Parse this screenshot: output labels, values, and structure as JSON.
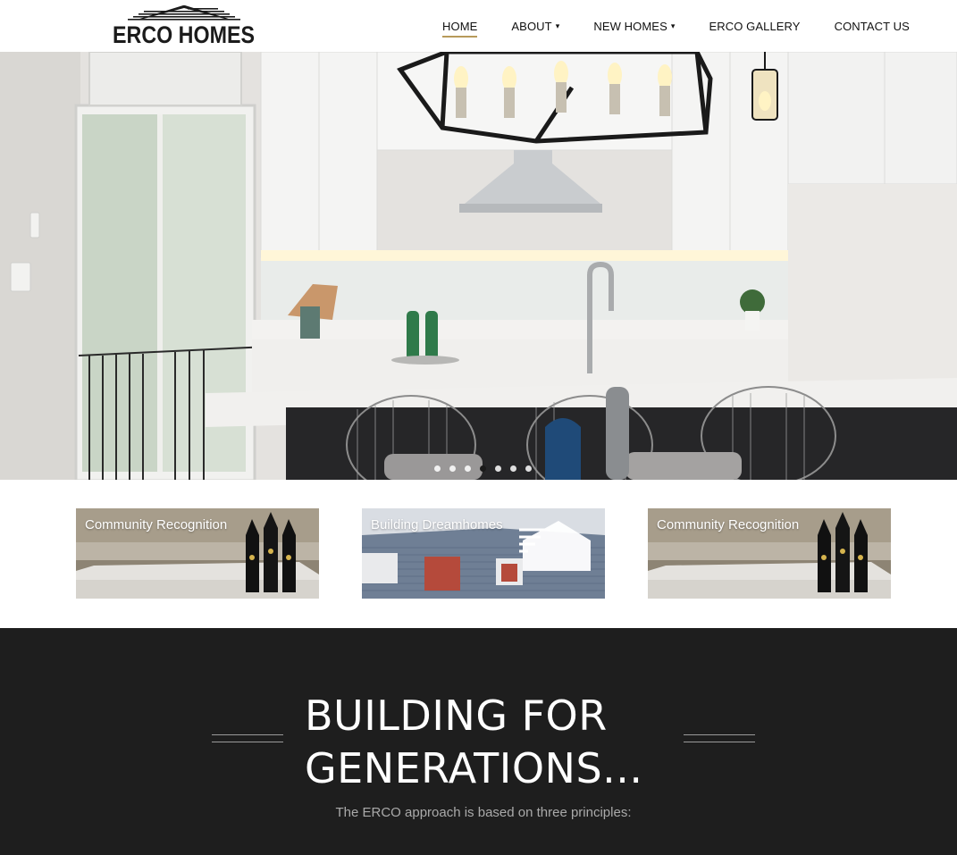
{
  "brand": {
    "logo_text": "ERCO HOMES"
  },
  "nav": {
    "items": [
      {
        "label": "HOME",
        "active": true,
        "has_dropdown": false
      },
      {
        "label": "ABOUT",
        "active": false,
        "has_dropdown": true
      },
      {
        "label": "NEW HOMES",
        "active": false,
        "has_dropdown": true
      },
      {
        "label": "ERCO GALLERY",
        "active": false,
        "has_dropdown": false
      },
      {
        "label": "CONTACT US",
        "active": false,
        "has_dropdown": false
      }
    ],
    "dropdown_glyph": "▾",
    "active_underline_color": "#b79a5a"
  },
  "hero": {
    "slide_count": 7,
    "active_slide": 4
  },
  "tiles": [
    {
      "label": "Community Recognition"
    },
    {
      "label": "Building Dreamhomes"
    },
    {
      "label": "Community Recognition"
    }
  ],
  "intro": {
    "heading_line1": "BUILDING FOR",
    "heading_line2": "GENERATIONS...",
    "subtext": "The ERCO approach is based on three principles:",
    "background": "#1e1e1e"
  }
}
